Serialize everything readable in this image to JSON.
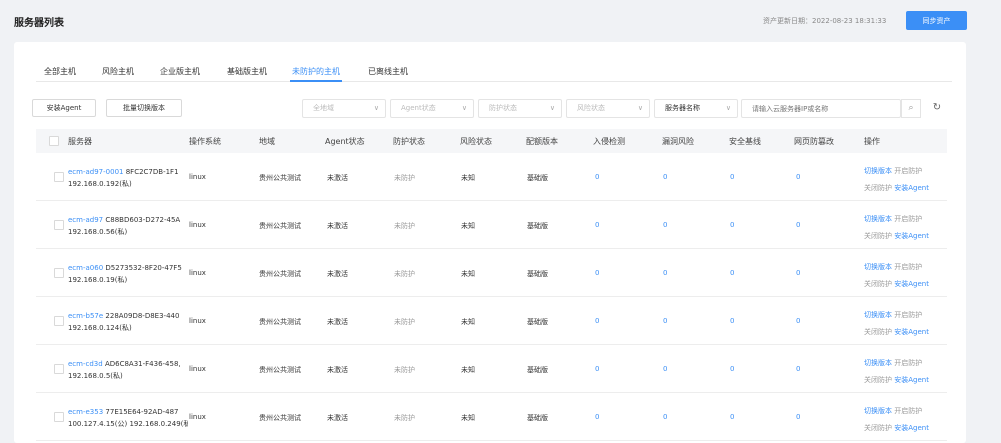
{
  "header": {
    "title": "服务器列表",
    "update_date": "资产更新日期：2022-08-23 18:31:33",
    "sync_label": "同步资产"
  },
  "tabs": [
    "全部主机",
    "风险主机",
    "企业版主机",
    "基础版主机",
    "未防护的主机",
    "已离线主机"
  ],
  "active_tab": "未防护的主机",
  "toolbar": {
    "install_agent": "安装Agent",
    "batch_switch": "批量切换版本",
    "filters": [
      "全地域",
      "Agent状态",
      "防护状态",
      "风险状态"
    ],
    "search_field": "服务器名称",
    "search_placeholder": "请输入云服务器IP或名称"
  },
  "table": {
    "columns": [
      "服务器",
      "操作系统",
      "地域",
      "Agent状态",
      "防护状态",
      "风险状态",
      "配额版本",
      "入侵检测",
      "漏洞风险",
      "安全基线",
      "网页防篡改",
      "操作"
    ],
    "rows": [
      {
        "name": "ecm-ad97-0001",
        "id": "8FC2C7DB-1F1",
        "ip": "192.168.0.192(私)",
        "os": "linux",
        "region": "贵州公共测试",
        "agent": "未激活",
        "protect": "未防护",
        "risk": "未知",
        "quota": "基础版",
        "intrusion": "0",
        "vuln": "0",
        "baseline": "0",
        "tamper": "0"
      },
      {
        "name": "ecm-ad97",
        "id": "C88BD603-D272-45A",
        "ip": "192.168.0.56(私)",
        "os": "linux",
        "region": "贵州公共测试",
        "agent": "未激活",
        "protect": "未防护",
        "risk": "未知",
        "quota": "基础版",
        "intrusion": "0",
        "vuln": "0",
        "baseline": "0",
        "tamper": "0"
      },
      {
        "name": "ecm-a060",
        "id": "D5273532-8F20-47F5",
        "ip": "192.168.0.19(私)",
        "os": "linux",
        "region": "贵州公共测试",
        "agent": "未激活",
        "protect": "未防护",
        "risk": "未知",
        "quota": "基础版",
        "intrusion": "0",
        "vuln": "0",
        "baseline": "0",
        "tamper": "0"
      },
      {
        "name": "ecm-b57e",
        "id": "228A09D8-D8E3-440",
        "ip": "192.168.0.124(私)",
        "os": "linux",
        "region": "贵州公共测试",
        "agent": "未激活",
        "protect": "未防护",
        "risk": "未知",
        "quota": "基础版",
        "intrusion": "0",
        "vuln": "0",
        "baseline": "0",
        "tamper": "0"
      },
      {
        "name": "ecm-cd3d",
        "id": "AD6C8A31-F436-458,",
        "ip": "192.168.0.5(私)",
        "os": "linux",
        "region": "贵州公共测试",
        "agent": "未激活",
        "protect": "未防护",
        "risk": "未知",
        "quota": "基础版",
        "intrusion": "0",
        "vuln": "0",
        "baseline": "0",
        "tamper": "0"
      },
      {
        "name": "ecm-e353",
        "id": "77E15E64-92AD-487",
        "ip": "100.127.4.15(公) 192.168.0.249(私",
        "os": "linux",
        "region": "贵州公共测试",
        "agent": "未激活",
        "protect": "未防护",
        "risk": "未知",
        "quota": "基础版",
        "intrusion": "0",
        "vuln": "0",
        "baseline": "0",
        "tamper": "0"
      }
    ],
    "actions": {
      "switch": "切换版本",
      "enable": "开启防护",
      "disable": "关闭防护",
      "install": "安装Agent"
    }
  },
  "colors": {
    "accent": "#3b8ff6",
    "background": "#f0f2f5",
    "header_row": "#f5f6f8"
  }
}
